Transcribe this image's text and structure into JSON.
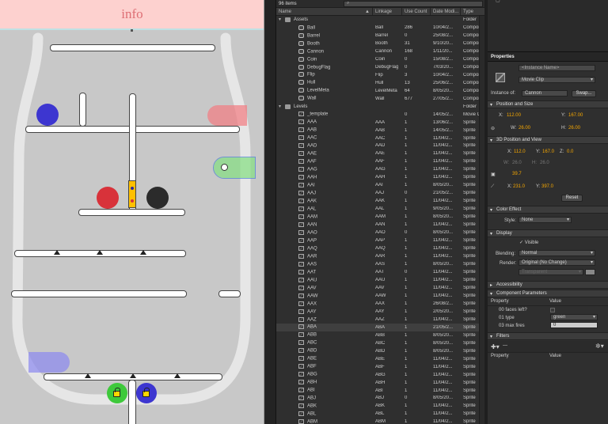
{
  "stage": {
    "info_text": "info",
    "colors": {
      "red": "#d8323a",
      "dark": "#2b2b2b",
      "blue": "#3d36d0",
      "green": "#3ec93b",
      "yellow": "#ffc000",
      "pink": "#f27a80",
      "lightgreen": "#84e082",
      "lavender": "#8a87f0"
    }
  },
  "library": {
    "item_count": "96 items",
    "columns": {
      "name": "Name",
      "linkage": "Linkage",
      "use_count": "Use Count",
      "date": "Date Modi...",
      "type": "Type"
    },
    "rows": [
      {
        "name": "Assets",
        "linkage": "",
        "use": "",
        "date": "",
        "type": "Folder",
        "kind": "folder",
        "level": 0
      },
      {
        "name": "Ball",
        "linkage": "Ball",
        "use": "286",
        "date": "10/04/2...",
        "type": "Compon",
        "kind": "clip",
        "level": 1
      },
      {
        "name": "Barrel",
        "linkage": "Barrel",
        "use": "0",
        "date": "25/08/2...",
        "type": "Compon",
        "kind": "clip",
        "level": 1
      },
      {
        "name": "Booth",
        "linkage": "Booth",
        "use": "31",
        "date": "9/10/20...",
        "type": "Compon",
        "kind": "clip",
        "level": 1
      },
      {
        "name": "Cannon",
        "linkage": "Cannon",
        "use": "168",
        "date": "1/11/20...",
        "type": "Compon",
        "kind": "clip",
        "level": 1
      },
      {
        "name": "Coin",
        "linkage": "Coin",
        "use": "0",
        "date": "15/08/2...",
        "type": "Compon",
        "kind": "clip",
        "level": 1
      },
      {
        "name": "DebugFlag",
        "linkage": "DebugFlag",
        "use": "0",
        "date": "7/03/20...",
        "type": "Compon",
        "kind": "clip",
        "level": 1
      },
      {
        "name": "Flip",
        "linkage": "Flip",
        "use": "3",
        "date": "10/04/2...",
        "type": "Compon",
        "kind": "clip",
        "level": 1
      },
      {
        "name": "Hull",
        "linkage": "Hull",
        "use": "13",
        "date": "25/06/2...",
        "type": "Compon",
        "kind": "clip",
        "level": 1
      },
      {
        "name": "LevelMeta",
        "linkage": "LevelMeta",
        "use": "64",
        "date": "8/05/20...",
        "type": "Compon",
        "kind": "clip",
        "level": 1
      },
      {
        "name": "Wall",
        "linkage": "Wall",
        "use": "677",
        "date": "27/05/2...",
        "type": "Compon",
        "kind": "clip",
        "level": 1
      },
      {
        "name": "Levels",
        "linkage": "",
        "use": "",
        "date": "",
        "type": "Folder",
        "kind": "folder",
        "level": 0
      },
      {
        "name": "_template",
        "linkage": "",
        "use": "0",
        "date": "14/05/2...",
        "type": "Movie Cl",
        "kind": "sprite",
        "level": 1
      },
      {
        "name": "AAA",
        "linkage": "AAA",
        "use": "1",
        "date": "13/06/2...",
        "type": "Sprite",
        "kind": "sprite",
        "level": 1
      },
      {
        "name": "AAB",
        "linkage": "AAB",
        "use": "1",
        "date": "14/05/2...",
        "type": "Sprite",
        "kind": "sprite",
        "level": 1
      },
      {
        "name": "AAC",
        "linkage": "AAC",
        "use": "1",
        "date": "11/04/2...",
        "type": "Sprite",
        "kind": "sprite",
        "level": 1
      },
      {
        "name": "AAD",
        "linkage": "AAD",
        "use": "1",
        "date": "11/04/2...",
        "type": "Sprite",
        "kind": "sprite",
        "level": 1
      },
      {
        "name": "AAE",
        "linkage": "AAE",
        "use": "1",
        "date": "11/04/2...",
        "type": "Sprite",
        "kind": "sprite",
        "level": 1
      },
      {
        "name": "AAF",
        "linkage": "AAF",
        "use": "1",
        "date": "11/04/2...",
        "type": "Sprite",
        "kind": "sprite",
        "level": 1
      },
      {
        "name": "AAG",
        "linkage": "AAG",
        "use": "1",
        "date": "11/04/2...",
        "type": "Sprite",
        "kind": "sprite",
        "level": 1
      },
      {
        "name": "AAH",
        "linkage": "AAH",
        "use": "1",
        "date": "11/04/2...",
        "type": "Sprite",
        "kind": "sprite",
        "level": 1
      },
      {
        "name": "AAI",
        "linkage": "AAI",
        "use": "1",
        "date": "8/05/20...",
        "type": "Sprite",
        "kind": "sprite",
        "level": 1
      },
      {
        "name": "AAJ",
        "linkage": "AAJ",
        "use": "0",
        "date": "21/05/2...",
        "type": "Sprite",
        "kind": "sprite",
        "level": 1
      },
      {
        "name": "AAK",
        "linkage": "AAK",
        "use": "1",
        "date": "11/04/2...",
        "type": "Sprite",
        "kind": "sprite",
        "level": 1
      },
      {
        "name": "AAL",
        "linkage": "AAL",
        "use": "1",
        "date": "9/05/20...",
        "type": "Sprite",
        "kind": "sprite",
        "level": 1
      },
      {
        "name": "AAM",
        "linkage": "AAM",
        "use": "1",
        "date": "8/05/20...",
        "type": "Sprite",
        "kind": "sprite",
        "level": 1
      },
      {
        "name": "AAN",
        "linkage": "AAN",
        "use": "1",
        "date": "11/04/2...",
        "type": "Sprite",
        "kind": "sprite",
        "level": 1
      },
      {
        "name": "AAO",
        "linkage": "AAO",
        "use": "0",
        "date": "8/05/20...",
        "type": "Sprite",
        "kind": "sprite",
        "level": 1
      },
      {
        "name": "AAP",
        "linkage": "AAP",
        "use": "1",
        "date": "11/04/2...",
        "type": "Sprite",
        "kind": "sprite",
        "level": 1
      },
      {
        "name": "AAQ",
        "linkage": "AAQ",
        "use": "1",
        "date": "11/04/2...",
        "type": "Sprite",
        "kind": "sprite",
        "level": 1
      },
      {
        "name": "AAR",
        "linkage": "AAR",
        "use": "1",
        "date": "11/04/2...",
        "type": "Sprite",
        "kind": "sprite",
        "level": 1
      },
      {
        "name": "AAS",
        "linkage": "AAS",
        "use": "1",
        "date": "8/05/20...",
        "type": "Sprite",
        "kind": "sprite",
        "level": 1
      },
      {
        "name": "AAT",
        "linkage": "AAT",
        "use": "0",
        "date": "11/04/2...",
        "type": "Sprite",
        "kind": "sprite",
        "level": 1
      },
      {
        "name": "AAU",
        "linkage": "AAU",
        "use": "1",
        "date": "11/04/2...",
        "type": "Sprite",
        "kind": "sprite",
        "level": 1
      },
      {
        "name": "AAV",
        "linkage": "AAV",
        "use": "1",
        "date": "11/04/2...",
        "type": "Sprite",
        "kind": "sprite",
        "level": 1
      },
      {
        "name": "AAW",
        "linkage": "AAW",
        "use": "1",
        "date": "11/04/2...",
        "type": "Sprite",
        "kind": "sprite",
        "level": 1
      },
      {
        "name": "AAX",
        "linkage": "AAX",
        "use": "1",
        "date": "26/08/2...",
        "type": "Sprite",
        "kind": "sprite",
        "level": 1
      },
      {
        "name": "AAY",
        "linkage": "AAY",
        "use": "1",
        "date": "2/05/20...",
        "type": "Sprite",
        "kind": "sprite",
        "level": 1
      },
      {
        "name": "AAZ",
        "linkage": "AAZ",
        "use": "1",
        "date": "11/04/2...",
        "type": "Sprite",
        "kind": "sprite",
        "level": 1
      },
      {
        "name": "ABA",
        "linkage": "ABA",
        "use": "1",
        "date": "21/05/2...",
        "type": "Sprite",
        "kind": "sprite",
        "level": 1
      },
      {
        "name": "ABB",
        "linkage": "ABB",
        "use": "1",
        "date": "8/05/20...",
        "type": "Sprite",
        "kind": "sprite",
        "level": 1
      },
      {
        "name": "ABC",
        "linkage": "ABC",
        "use": "1",
        "date": "8/05/20...",
        "type": "Sprite",
        "kind": "sprite",
        "level": 1
      },
      {
        "name": "ABD",
        "linkage": "ABD",
        "use": "1",
        "date": "8/05/20...",
        "type": "Sprite",
        "kind": "sprite",
        "level": 1
      },
      {
        "name": "ABE",
        "linkage": "ABE",
        "use": "1",
        "date": "11/04/2...",
        "type": "Sprite",
        "kind": "sprite",
        "level": 1
      },
      {
        "name": "ABF",
        "linkage": "ABF",
        "use": "1",
        "date": "11/04/2...",
        "type": "Sprite",
        "kind": "sprite",
        "level": 1
      },
      {
        "name": "ABG",
        "linkage": "ABG",
        "use": "1",
        "date": "11/04/2...",
        "type": "Sprite",
        "kind": "sprite",
        "level": 1
      },
      {
        "name": "ABH",
        "linkage": "ABH",
        "use": "1",
        "date": "11/04/2...",
        "type": "Sprite",
        "kind": "sprite",
        "level": 1
      },
      {
        "name": "ABI",
        "linkage": "ABI",
        "use": "1",
        "date": "11/04/2...",
        "type": "Sprite",
        "kind": "sprite",
        "level": 1
      },
      {
        "name": "ABJ",
        "linkage": "ABJ",
        "use": "0",
        "date": "8/05/20...",
        "type": "Sprite",
        "kind": "sprite",
        "level": 1
      },
      {
        "name": "ABK",
        "linkage": "ABK",
        "use": "1",
        "date": "11/04/2...",
        "type": "Sprite",
        "kind": "sprite",
        "level": 1
      },
      {
        "name": "ABL",
        "linkage": "ABL",
        "use": "1",
        "date": "11/04/2...",
        "type": "Sprite",
        "kind": "sprite",
        "level": 1
      },
      {
        "name": "ABM",
        "linkage": "ABM",
        "use": "1",
        "date": "11/04/2...",
        "type": "Sprite",
        "kind": "sprite",
        "level": 1
      }
    ],
    "selected_index": 39
  },
  "properties": {
    "tab_label": "Properties",
    "instance_name_placeholder": "<Instance Name>",
    "symbol_type": "Movie Clip",
    "instance_of_label": "Instance of:",
    "instance_of_value": "Cannon",
    "swap_label": "Swap...",
    "pos_size": {
      "header": "Position and Size",
      "x_label": "X:",
      "x": "112.00",
      "y_label": "Y:",
      "y": "167.00",
      "w_label": "W:",
      "w": "26.00",
      "h_label": "H:",
      "h": "26.00"
    },
    "pos3d": {
      "header": "3D Position and View",
      "x_label": "X:",
      "x": "112.0",
      "y_label": "Y:",
      "y": "167.0",
      "z_label": "Z:",
      "z": "0.0",
      "w_label": "W:",
      "w": "26.0",
      "h_label": "H:",
      "h": "26.0",
      "perspective": "39.7",
      "vx_label": "X:",
      "vx": "231.0",
      "vy_label": "Y:",
      "vy": "397.0",
      "reset_label": "Reset"
    },
    "color_effect": {
      "header": "Color Effect",
      "style_label": "Style:",
      "style_value": "None"
    },
    "display": {
      "header": "Display",
      "visible_label": "Visible",
      "blending_label": "Blending:",
      "blending_value": "Normal",
      "render_label": "Render:",
      "render_value": "Original (No Change)",
      "transparent_value": "Transparent"
    },
    "accessibility": {
      "header": "Accessibility"
    },
    "component_params": {
      "header": "Component Parameters",
      "property_col": "Property",
      "value_col": "Value",
      "params": [
        {
          "name": "00 faces left?",
          "value": ""
        },
        {
          "name": "01 type",
          "value": "green"
        },
        {
          "name": "03 max fires",
          "value": "0"
        }
      ]
    },
    "filters": {
      "header": "Filters",
      "property_col": "Property",
      "value_col": "Value"
    }
  }
}
